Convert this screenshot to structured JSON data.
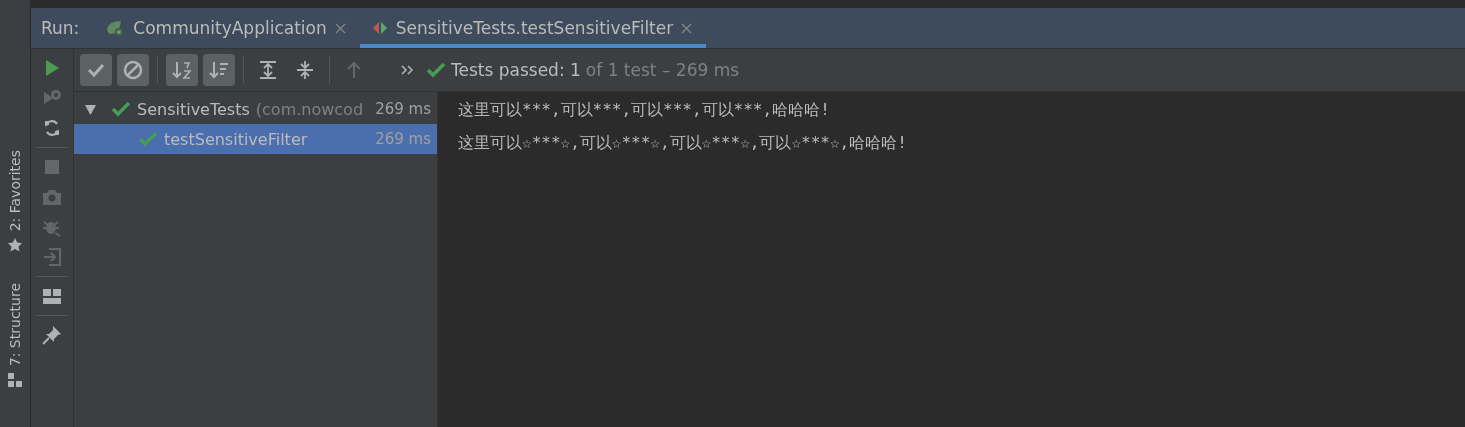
{
  "run_bar": {
    "label": "Run:",
    "tabs": [
      {
        "label": "CommunityApplication",
        "kind": "spring",
        "selected": false
      },
      {
        "label": "SensitiveTests.testSensitiveFilter",
        "kind": "test",
        "selected": true
      }
    ]
  },
  "side_panels": [
    {
      "label": "2: Favorites",
      "kind": "star"
    },
    {
      "label": "7: Structure",
      "kind": "structure"
    }
  ],
  "left_toolbar": [
    {
      "kind": "run",
      "disabled": false
    },
    {
      "kind": "rerun-failed",
      "disabled": true
    },
    {
      "kind": "auto-test",
      "disabled": false
    },
    {
      "kind": "separator"
    },
    {
      "kind": "stop",
      "disabled": true
    },
    {
      "kind": "camera",
      "disabled": true
    },
    {
      "kind": "debug",
      "disabled": true
    },
    {
      "kind": "import",
      "disabled": true
    },
    {
      "kind": "separator"
    },
    {
      "kind": "layout",
      "disabled": false
    },
    {
      "kind": "separator"
    },
    {
      "kind": "pin",
      "disabled": false
    }
  ],
  "test_toolbar": [
    {
      "kind": "show-passed",
      "selected": true,
      "disabled": false
    },
    {
      "kind": "show-ignored",
      "selected": true,
      "disabled": false
    },
    {
      "kind": "separator"
    },
    {
      "kind": "sort-alpha",
      "selected": true,
      "disabled": false
    },
    {
      "kind": "sort-duration",
      "selected": true,
      "disabled": false
    },
    {
      "kind": "separator"
    },
    {
      "kind": "expand-all",
      "selected": false,
      "disabled": false
    },
    {
      "kind": "collapse-all",
      "selected": false,
      "disabled": false
    },
    {
      "kind": "separator"
    },
    {
      "kind": "previous",
      "selected": false,
      "disabled": true
    },
    {
      "kind": "more",
      "selected": false,
      "disabled": false
    }
  ],
  "status": {
    "passed": "Tests passed: 1",
    "detail": "of 1 test – 269 ms"
  },
  "tree": [
    {
      "name": "SensitiveTests",
      "package": "(com.nowcod",
      "time": "269 ms",
      "passed": true,
      "expanded": true,
      "selected": false,
      "children": [
        {
          "name": "testSensitiveFilter",
          "time": "269 ms",
          "passed": true,
          "selected": true
        }
      ]
    }
  ],
  "console": [
    "这里可以***,可以***,可以***,可以***,哈哈哈!",
    "这里可以☆***☆,可以☆***☆,可以☆***☆,可以☆***☆,哈哈哈!"
  ]
}
